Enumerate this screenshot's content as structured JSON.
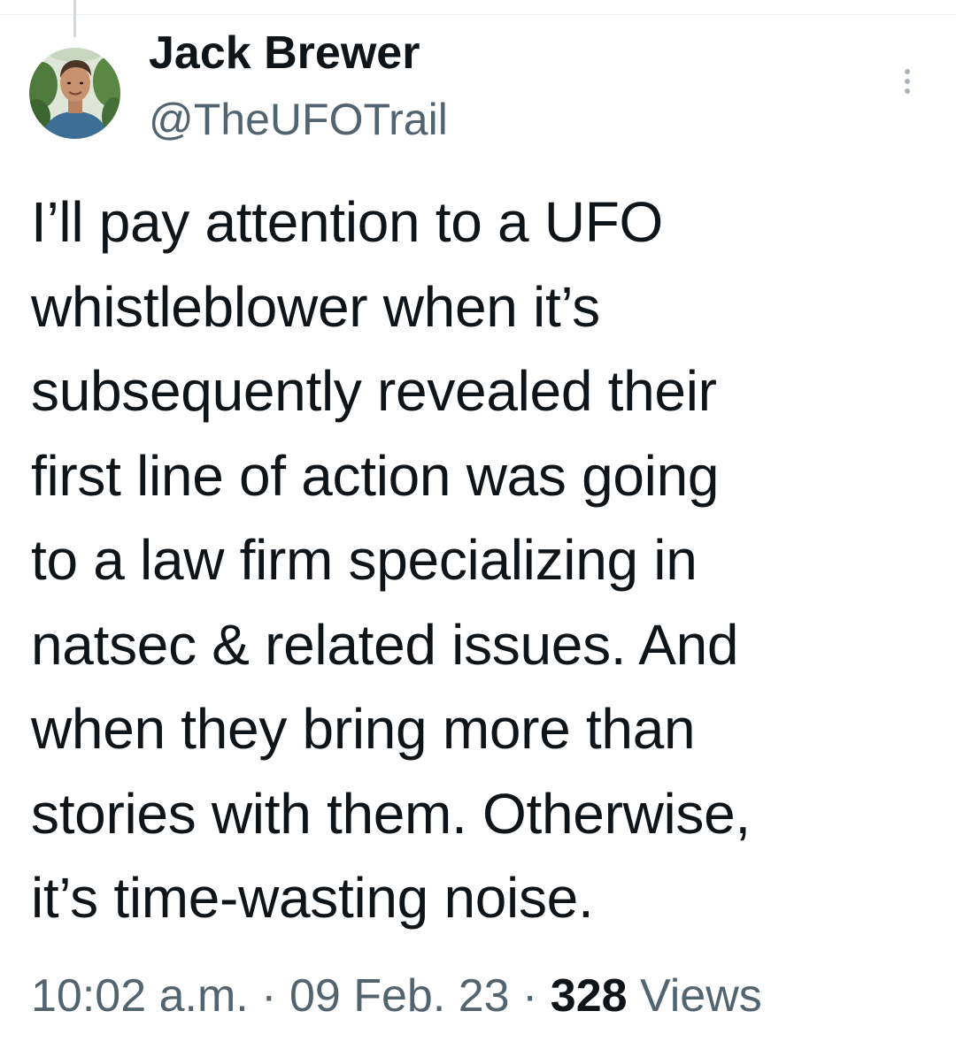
{
  "author": {
    "display_name": "Jack Brewer",
    "handle": "@TheUFOTrail"
  },
  "tweet": {
    "text": "I’ll pay attention to a UFO\nwhistleblower when it’s\nsubsequently revealed their\nfirst line of action was going\nto a law firm specializing in\nnatsec & related issues. And\nwhen they bring more than\nstories with them. Otherwise,\nit’s time-wasting noise."
  },
  "meta": {
    "time": "10:02 a.m.",
    "separator": " · ",
    "date": "09 Feb. 23",
    "views_count": "328",
    "views_label": " Views"
  },
  "icons": {
    "more": "more-vertical-icon",
    "avatar": "profile-photo"
  },
  "colors": {
    "text_primary": "#0f1419",
    "text_secondary": "#536471",
    "background": "#ffffff"
  }
}
